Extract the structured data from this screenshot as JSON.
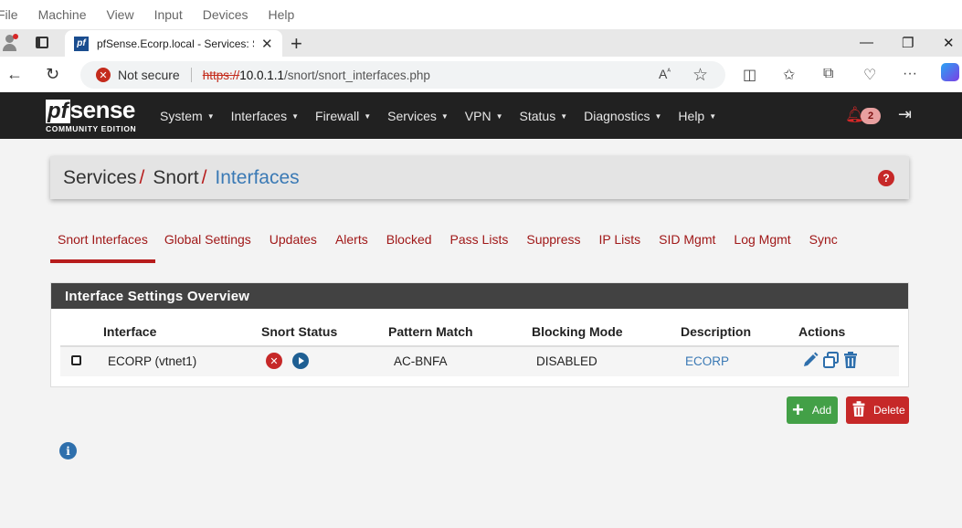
{
  "vm_menu": [
    "File",
    "Machine",
    "View",
    "Input",
    "Devices",
    "Help"
  ],
  "browser": {
    "tab_title": "pfSense.Ecorp.local - Services: Sn",
    "tab_favicon": "pf",
    "security_label": "Not secure",
    "url_protocol": "https://",
    "url_host": "10.0.1.1",
    "url_path": "/snort/snort_interfaces.php"
  },
  "pfsense": {
    "logo_pf": "pf",
    "logo_sense": "sense",
    "logo_edition": "COMMUNITY EDITION",
    "menu": [
      "System",
      "Interfaces",
      "Firewall",
      "Services",
      "VPN",
      "Status",
      "Diagnostics",
      "Help"
    ],
    "notification_count": "2"
  },
  "breadcrumb": {
    "items": [
      "Services",
      "Snort"
    ],
    "separator": "/",
    "active": "Interfaces"
  },
  "tabs": [
    "Snort Interfaces",
    "Global Settings",
    "Updates",
    "Alerts",
    "Blocked",
    "Pass Lists",
    "Suppress",
    "IP Lists",
    "SID Mgmt",
    "Log Mgmt",
    "Sync"
  ],
  "panel": {
    "title": "Interface Settings Overview",
    "columns": [
      "Interface",
      "Snort Status",
      "Pattern Match",
      "Blocking Mode",
      "Description",
      "Actions"
    ],
    "rows": [
      {
        "interface": "ECORP (vtnet1)",
        "status": "stopped",
        "pattern_match": "AC-BNFA",
        "blocking_mode": "DISABLED",
        "description": "ECORP"
      }
    ]
  },
  "buttons": {
    "add": "Add",
    "delete": "Delete"
  },
  "colors": {
    "accent_red": "#b71c1c",
    "link_blue": "#3b7ab5",
    "navbar": "#212121",
    "add_green": "#43a047"
  }
}
